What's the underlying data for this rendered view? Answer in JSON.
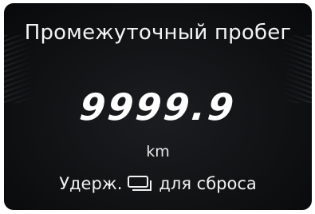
{
  "screen": {
    "title": "Промежуточный пробег",
    "value": "9999.9",
    "unit": "km",
    "hint_prefix": "Удерж.",
    "hint_suffix": "для сброса",
    "hint_icon": "button-icon"
  }
}
